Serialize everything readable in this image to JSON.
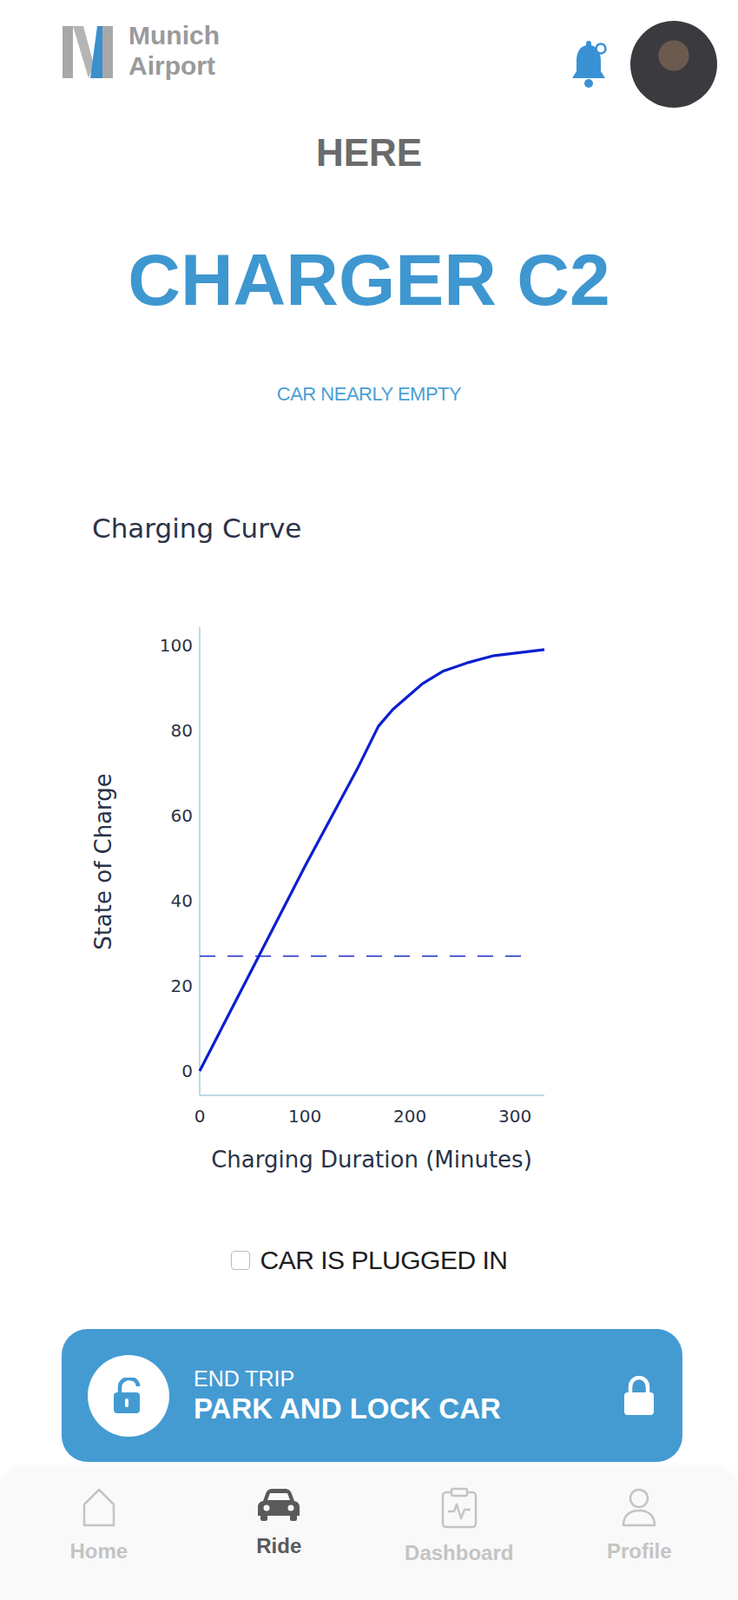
{
  "header": {
    "brand": [
      "Munich",
      "Airport"
    ],
    "notifications": {
      "unread": true
    }
  },
  "location_label": "HERE",
  "charger": "CHARGER C2",
  "status": "CAR NEARLY EMPTY",
  "chart": {
    "title": "Charging Curve",
    "y_axis": {
      "label": "State of Charge",
      "ticks": [
        "0",
        "20",
        "40",
        "60",
        "80",
        "100"
      ],
      "range": [
        0,
        100
      ]
    },
    "x_axis": {
      "label": "Charging Duration (Minutes)",
      "ticks": [
        "0",
        "100",
        "200",
        "300"
      ],
      "range": [
        0,
        328
      ]
    },
    "series": [
      {
        "minutes": [
          0,
          50,
          100,
          150,
          170,
          184,
          198,
          212,
          232,
          256,
          280,
          328
        ],
        "soc": [
          0,
          24,
          48,
          71,
          81,
          85,
          88,
          91,
          94,
          96,
          97.6,
          99
        ]
      }
    ],
    "threshold": {
      "value": 27,
      "from": 0,
      "until": 313
    }
  },
  "plugged_in": {
    "label": "CAR IS PLUGGED IN",
    "checked": false
  },
  "action": {
    "small": "END TRIP",
    "label": "PARK AND LOCK CAR"
  },
  "nav": [
    {
      "label": "Home",
      "selected": false
    },
    {
      "label": "Ride",
      "selected": true
    },
    {
      "label": "Dashboard",
      "selected": false
    },
    {
      "label": "Profile",
      "selected": false
    }
  ]
}
